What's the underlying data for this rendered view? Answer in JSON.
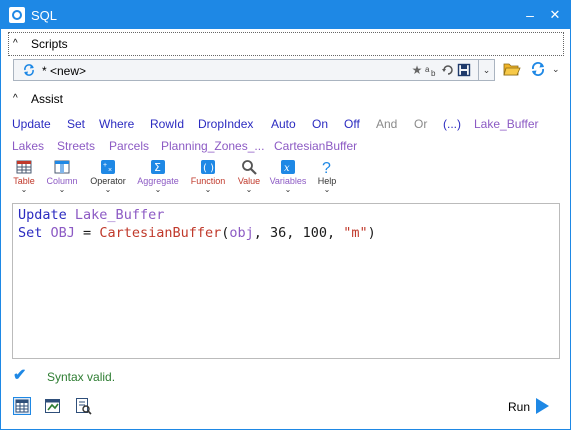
{
  "window": {
    "title": "SQL",
    "minimize_glyph": "–",
    "maximize_glyph": "☐",
    "close_glyph": "✕"
  },
  "scripts": {
    "label": "Scripts",
    "caret": "^"
  },
  "script_selector": {
    "value": "* <new>",
    "dropdown_glyph": "⌄"
  },
  "assist": {
    "label": "Assist",
    "caret": "^"
  },
  "keywords_row1": [
    {
      "label": "Update",
      "tone": "blue"
    },
    {
      "label": "Set",
      "tone": "blue"
    },
    {
      "label": "Where",
      "tone": "blue"
    },
    {
      "label": "RowId",
      "tone": "blue"
    },
    {
      "label": "DropIndex",
      "tone": "blue"
    },
    {
      "label": "Auto",
      "tone": "blue"
    },
    {
      "label": "On",
      "tone": "blue"
    },
    {
      "label": "Off",
      "tone": "blue"
    },
    {
      "label": "And",
      "tone": "gray"
    },
    {
      "label": "Or",
      "tone": "gray"
    },
    {
      "label": "(...)",
      "tone": "blue"
    },
    {
      "label": "Lake_Buffer",
      "tone": "purple"
    }
  ],
  "keywords_row2": [
    {
      "label": "Lakes",
      "tone": "purple"
    },
    {
      "label": "Streets",
      "tone": "purple"
    },
    {
      "label": "Parcels",
      "tone": "purple"
    },
    {
      "label": "Planning_Zones_...",
      "tone": "purple"
    },
    {
      "label": "CartesianBuffer",
      "tone": "purple"
    }
  ],
  "toolbar": [
    {
      "label": "Table",
      "icon": "table-icon",
      "color": "#c0392b"
    },
    {
      "label": "Column",
      "icon": "column-icon",
      "color": "#8c5ac4"
    },
    {
      "label": "Operator",
      "icon": "operator-icon",
      "color": "#333333"
    },
    {
      "label": "Aggregate",
      "icon": "sigma-icon",
      "color": "#8c5ac4"
    },
    {
      "label": "Function",
      "icon": "function-icon",
      "color": "#c0392b"
    },
    {
      "label": "Value",
      "icon": "magnifier-icon",
      "color": "#c0392b"
    },
    {
      "label": "Variables",
      "icon": "variable-icon",
      "color": "#8c5ac4"
    },
    {
      "label": "Help",
      "icon": "help-icon",
      "color": "#333333"
    }
  ],
  "editor": {
    "line1": {
      "kw": "Update",
      "table": "Lake_Buffer"
    },
    "line2": {
      "kw": "Set",
      "target": "OBJ",
      "eq": " = ",
      "fn": "CartesianBuffer",
      "open": "(",
      "arg1": "obj",
      "sep1": ", ",
      "arg2": "36",
      "sep2": ", ",
      "arg3": "100",
      "sep3": ", ",
      "arg4": "\"m\"",
      "close": ")"
    }
  },
  "status": {
    "check_glyph": "✔",
    "message": "Syntax valid."
  },
  "run": {
    "label": "Run"
  },
  "colors": {
    "accent": "#1e88e5",
    "keyword": "#2b2bc0",
    "table": "#8c5ac4",
    "function": "#c0392b",
    "ok": "#2e7d32"
  }
}
